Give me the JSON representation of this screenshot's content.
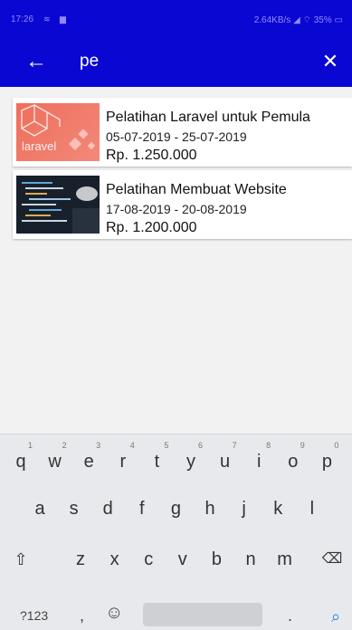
{
  "status_bar": {
    "time": "17:26",
    "speed": "2.64KB/s",
    "battery": "35%"
  },
  "app_bar": {
    "search_query": "pe"
  },
  "results": [
    {
      "title": "Pelatihan Laravel untuk Pemula",
      "date": "05-07-2019 - 25-07-2019",
      "price": "Rp. 1.250.000",
      "thumb_label": "laravel"
    },
    {
      "title": "Pelatihan Membuat Website",
      "date": "17-08-2019 - 20-08-2019",
      "price": "Rp. 1.200.000"
    }
  ],
  "keyboard": {
    "row1": [
      "q",
      "w",
      "e",
      "r",
      "t",
      "y",
      "u",
      "i",
      "o",
      "p"
    ],
    "row1_hints": [
      "1",
      "2",
      "3",
      "4",
      "5",
      "6",
      "7",
      "8",
      "9",
      "0"
    ],
    "row2": [
      "a",
      "s",
      "d",
      "f",
      "g",
      "h",
      "j",
      "k",
      "l"
    ],
    "row3": [
      "z",
      "x",
      "c",
      "v",
      "b",
      "n",
      "m"
    ],
    "numbers_label": "?123",
    "comma": ",",
    "period": ".",
    "emoji_icon": "smiley-icon",
    "shift_icon": "shift-icon",
    "backspace_icon": "backspace-icon",
    "search_icon": "search-icon"
  },
  "colors": {
    "app_bar": "#0a07d3",
    "laravel_thumb": "#ef6e5b",
    "search_key": "#1e88e5"
  }
}
